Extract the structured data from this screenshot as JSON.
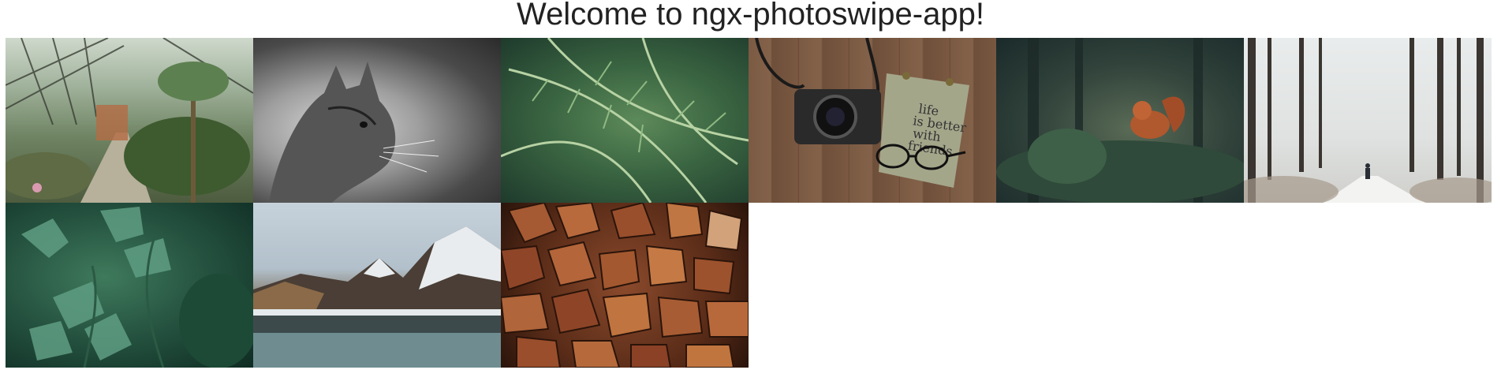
{
  "page": {
    "title": "Welcome to ngx-photoswipe-app!"
  },
  "gallery": {
    "images": [
      {
        "name": "greenhouse"
      },
      {
        "name": "cat"
      },
      {
        "name": "fern"
      },
      {
        "name": "camera"
      },
      {
        "name": "squirrel"
      },
      {
        "name": "forest"
      },
      {
        "name": "parsley"
      },
      {
        "name": "mountain"
      },
      {
        "name": "wood"
      }
    ]
  },
  "camera_note": {
    "text": "life is better with friends"
  }
}
